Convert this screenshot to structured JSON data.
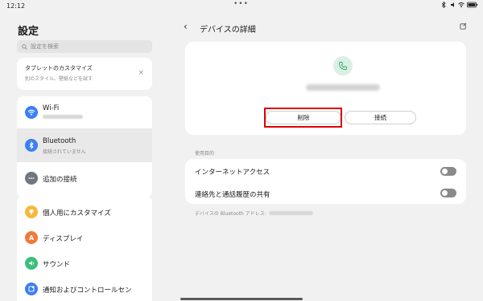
{
  "status_bar": {
    "time": "12:12",
    "dots": "•••"
  },
  "left": {
    "title": "設定",
    "search_placeholder": "設定を検索",
    "promo": {
      "title": "タブレットのカスタマイズ",
      "subtitle": "別のスタイル、壁紙などを試す",
      "close": "×"
    },
    "group1": [
      {
        "label": "Wi-Fi",
        "icon": "wifi-icon",
        "color": "#3b7ff5"
      },
      {
        "label": "Bluetooth",
        "sub": "接続されていません",
        "icon": "bluetooth-icon",
        "color": "#3b7ff5"
      },
      {
        "label": "追加の接続",
        "icon": "more-dots-icon",
        "color": "#6f7780"
      }
    ],
    "group2": [
      {
        "label": "個人用にカスタマイズ",
        "icon": "palette-icon",
        "color": "#f5b93a"
      },
      {
        "label": "ディスプレイ",
        "icon": "display-icon",
        "color": "#f07a3b"
      },
      {
        "label": "サウンド",
        "icon": "sound-icon",
        "color": "#3cbf79"
      },
      {
        "label": "通知およびコントロールセン",
        "icon": "notification-icon",
        "color": "#3b7ff5"
      }
    ]
  },
  "right": {
    "back": "‹",
    "title": "デバイスの詳細",
    "device_icon_color": "#2fa866",
    "delete_label": "削除",
    "connect_label": "接続",
    "section_label": "使用目的",
    "options": [
      {
        "label": "インターネットアクセス"
      },
      {
        "label": "連絡先と通話履歴の共有"
      }
    ],
    "address_label": "デバイスの Bluetooth アドレス:"
  },
  "colors": {
    "highlight": "#e00000",
    "accent": "#3b7ff5"
  }
}
